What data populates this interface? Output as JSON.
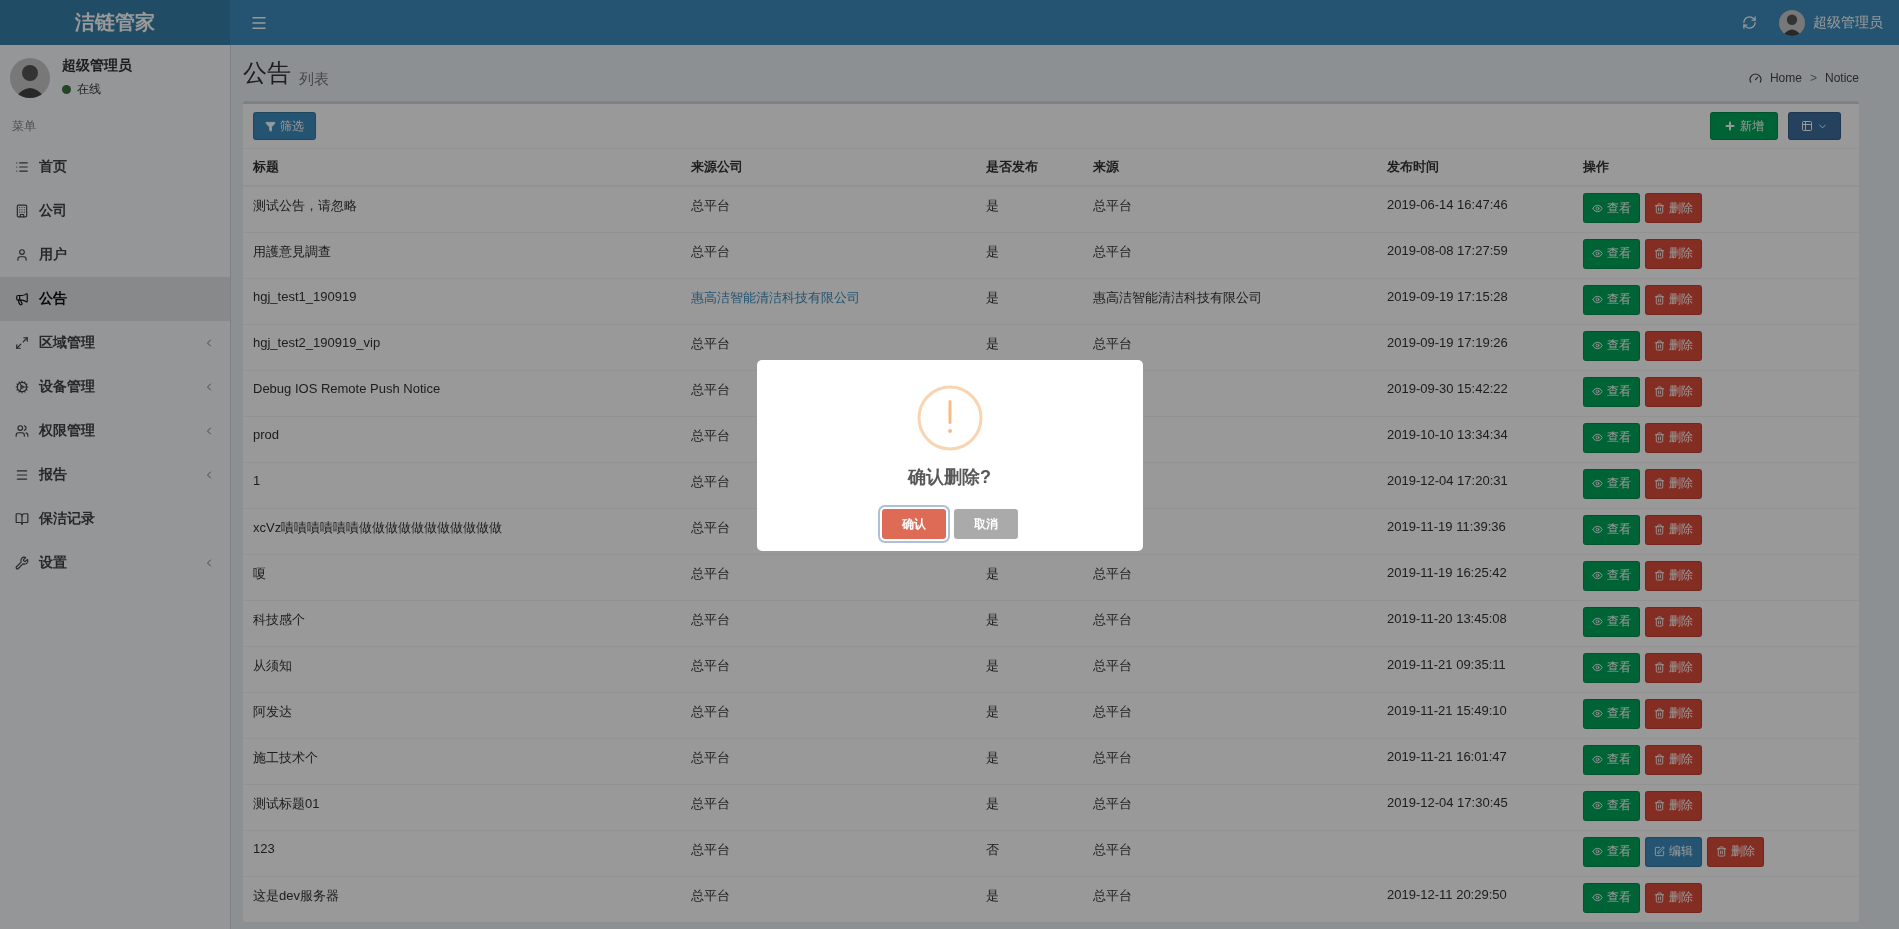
{
  "app": {
    "title": "洁链管家"
  },
  "header": {
    "user": "超级管理员"
  },
  "sidebar": {
    "user": {
      "name": "超级管理员",
      "status": "在线"
    },
    "section": "菜单",
    "items": [
      {
        "label": "首页",
        "selected": false,
        "submenu": false
      },
      {
        "label": "公司",
        "selected": false,
        "submenu": false
      },
      {
        "label": "用户",
        "selected": false,
        "submenu": false
      },
      {
        "label": "公告",
        "selected": true,
        "submenu": false
      },
      {
        "label": "区域管理",
        "selected": false,
        "submenu": true
      },
      {
        "label": "设备管理",
        "selected": false,
        "submenu": true
      },
      {
        "label": "权限管理",
        "selected": false,
        "submenu": true
      },
      {
        "label": "报告",
        "selected": false,
        "submenu": true
      },
      {
        "label": "保洁记录",
        "selected": false,
        "submenu": false
      },
      {
        "label": "设置",
        "selected": false,
        "submenu": true
      }
    ]
  },
  "page": {
    "title": "公告",
    "subtitle": "列表",
    "breadcrumb": {
      "items": [
        "Home",
        "Notice"
      ],
      "separator": ">"
    }
  },
  "toolbar": {
    "filter": "筛选",
    "add": "新增"
  },
  "table": {
    "columns": [
      "标题",
      "来源公司",
      "是否发布",
      "来源",
      "发布时间",
      "操作"
    ],
    "rows": [
      {
        "title": "测试公告，请忽略",
        "company": "总平台",
        "company_link": false,
        "published": "是",
        "source": "总平台",
        "time": "2019-06-14 16:47:46",
        "actions": [
          {
            "kind": "view",
            "label": "查看"
          },
          {
            "kind": "delete",
            "label": "删除"
          }
        ]
      },
      {
        "title": "用護意見調查",
        "company": "总平台",
        "company_link": false,
        "published": "是",
        "source": "总平台",
        "time": "2019-08-08 17:27:59",
        "actions": [
          {
            "kind": "view",
            "label": "查看"
          },
          {
            "kind": "delete",
            "label": "删除"
          }
        ]
      },
      {
        "title": "hgj_test1_190919",
        "company": "惠高洁智能清洁科技有限公司",
        "company_link": true,
        "published": "是",
        "source": "惠高洁智能清洁科技有限公司",
        "time": "2019-09-19 17:15:28",
        "actions": [
          {
            "kind": "view",
            "label": "查看"
          },
          {
            "kind": "delete",
            "label": "删除"
          }
        ]
      },
      {
        "title": "hgj_test2_190919_vip",
        "company": "总平台",
        "company_link": false,
        "published": "是",
        "source": "总平台",
        "time": "2019-09-19 17:19:26",
        "actions": [
          {
            "kind": "view",
            "label": "查看"
          },
          {
            "kind": "delete",
            "label": "删除"
          }
        ]
      },
      {
        "title": "Debug IOS Remote Push Notice",
        "company": "总平台",
        "company_link": false,
        "time": "2019-09-30 15:42:22",
        "actions": [
          {
            "kind": "view",
            "label": "查看"
          },
          {
            "kind": "delete",
            "label": "删除"
          }
        ]
      },
      {
        "title": "prod",
        "company": "总平台",
        "company_link": false,
        "time": "2019-10-10 13:34:34",
        "actions": [
          {
            "kind": "view",
            "label": "查看"
          },
          {
            "kind": "delete",
            "label": "删除"
          }
        ]
      },
      {
        "title": "1",
        "company": "总平台",
        "company_link": false,
        "time": "2019-12-04 17:20:31",
        "actions": [
          {
            "kind": "view",
            "label": "查看"
          },
          {
            "kind": "delete",
            "label": "删除"
          }
        ]
      },
      {
        "title": "xcVz嘖嘖嘖嘖嘖嘖做做做做做做做做做做做",
        "company": "总平台",
        "company_link": false,
        "time": "2019-11-19 11:39:36",
        "actions": [
          {
            "kind": "view",
            "label": "查看"
          },
          {
            "kind": "delete",
            "label": "删除"
          }
        ]
      },
      {
        "title": "嗄",
        "company": "总平台",
        "company_link": false,
        "published": "是",
        "source": "总平台",
        "time": "2019-11-19 16:25:42",
        "actions": [
          {
            "kind": "view",
            "label": "查看"
          },
          {
            "kind": "delete",
            "label": "删除"
          }
        ]
      },
      {
        "title": "科技感个",
        "company": "总平台",
        "company_link": false,
        "published": "是",
        "source": "总平台",
        "time": "2019-11-20 13:45:08",
        "actions": [
          {
            "kind": "view",
            "label": "查看"
          },
          {
            "kind": "delete",
            "label": "删除"
          }
        ]
      },
      {
        "title": "从须知",
        "company": "总平台",
        "company_link": false,
        "published": "是",
        "source": "总平台",
        "time": "2019-11-21 09:35:11",
        "actions": [
          {
            "kind": "view",
            "label": "查看"
          },
          {
            "kind": "delete",
            "label": "删除"
          }
        ]
      },
      {
        "title": "阿发达",
        "company": "总平台",
        "company_link": false,
        "published": "是",
        "source": "总平台",
        "time": "2019-11-21 15:49:10",
        "actions": [
          {
            "kind": "view",
            "label": "查看"
          },
          {
            "kind": "delete",
            "label": "删除"
          }
        ]
      },
      {
        "title": "施工技术个",
        "company": "总平台",
        "company_link": false,
        "published": "是",
        "source": "总平台",
        "time": "2019-11-21 16:01:47",
        "actions": [
          {
            "kind": "view",
            "label": "查看"
          },
          {
            "kind": "delete",
            "label": "删除"
          }
        ]
      },
      {
        "title": "测试标题01",
        "company": "总平台",
        "company_link": false,
        "published": "是",
        "source": "总平台",
        "time": "2019-12-04 17:30:45",
        "actions": [
          {
            "kind": "view",
            "label": "查看"
          },
          {
            "kind": "delete",
            "label": "删除"
          }
        ]
      },
      {
        "title": "123",
        "company": "总平台",
        "company_link": false,
        "published": "否",
        "source": "总平台",
        "actions": [
          {
            "kind": "view",
            "label": "查看"
          },
          {
            "kind": "edit",
            "label": "编辑"
          },
          {
            "kind": "delete",
            "label": "删除"
          }
        ]
      },
      {
        "title": "这是dev服务器",
        "company": "总平台",
        "company_link": false,
        "published": "是",
        "source": "总平台",
        "time": "2019-12-11 20:29:50",
        "actions": [
          {
            "kind": "view",
            "label": "查看"
          },
          {
            "kind": "delete",
            "label": "删除"
          }
        ]
      }
    ]
  },
  "dialog": {
    "title": "确认删除?",
    "confirm": "确认",
    "cancel": "取消"
  }
}
